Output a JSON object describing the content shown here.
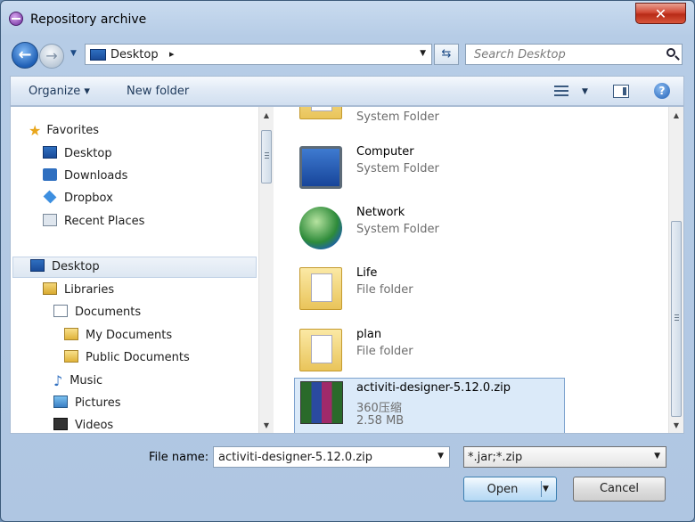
{
  "window": {
    "title": "Repository archive",
    "close_label": "✕"
  },
  "address": {
    "location": "Desktop",
    "separator": "▸",
    "search_placeholder": "Search Desktop"
  },
  "toolbar": {
    "organize_label": "Organize ▾",
    "new_folder_label": "New folder",
    "help_label": "?"
  },
  "nav": {
    "favorites": "Favorites",
    "items": [
      "Desktop",
      "Downloads",
      "Dropbox",
      "Recent Places"
    ],
    "desktop": "Desktop",
    "libraries": "Libraries",
    "documents": "Documents",
    "my_documents": "My Documents",
    "public_documents": "Public Documents",
    "music": "Music",
    "pictures": "Pictures",
    "videos": "Videos"
  },
  "files": [
    {
      "name": "",
      "type": "System Folder",
      "icon": "user-folder-icon"
    },
    {
      "name": "Computer",
      "type": "System Folder",
      "icon": "computer-icon"
    },
    {
      "name": "Network",
      "type": "System Folder",
      "icon": "network-icon"
    },
    {
      "name": "Life",
      "type": "File folder",
      "icon": "folder-icon"
    },
    {
      "name": "plan",
      "type": "File folder",
      "icon": "folder-icon"
    },
    {
      "name": "activiti-designer-5.12.0.zip",
      "type": "360压缩",
      "size": "2.58 MB",
      "icon": "archive-icon",
      "selected": true
    }
  ],
  "footer": {
    "file_name_label": "File name:",
    "file_name_value": "activiti-designer-5.12.0.zip",
    "filter_value": "*.jar;*.zip",
    "open_label": "Open",
    "cancel_label": "Cancel"
  },
  "colors": {
    "selection": "#dbeaf9",
    "close_button": "#c9391f",
    "title_bg": "#c9dbef"
  }
}
